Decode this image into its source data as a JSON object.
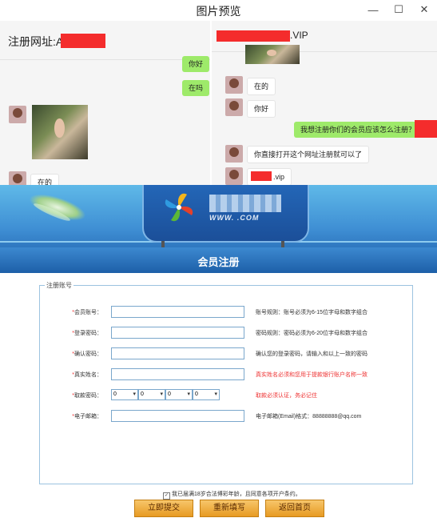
{
  "window": {
    "title": "图片预览"
  },
  "chat_left": {
    "header": "注册网址:AG",
    "messages": [
      {
        "text": "你好"
      },
      {
        "text": "在吗"
      },
      {
        "text": "在的"
      }
    ]
  },
  "chat_right": {
    "header_suffix": ".VIP",
    "messages": [
      {
        "text": "在的"
      },
      {
        "text": "你好"
      },
      {
        "text": "我想注册你们的会员应该怎么注册？"
      },
      {
        "text": "你直接打开这个网址注册就可以了"
      },
      {
        "text": ".vip"
      }
    ]
  },
  "site": {
    "logo_url": "WWW.        .COM",
    "section_title": "会员注册",
    "fieldset_legend": "注册账号",
    "fields": [
      {
        "label": "会员账号：",
        "hint": "账号规则：账号必须为6-15位字母和数字组合",
        "hint_red": false
      },
      {
        "label": "登录密码：",
        "hint": "密码规则：密码必须为6-20位字母和数字组合",
        "hint_red": false
      },
      {
        "label": "确认密码：",
        "hint": "确认您的登录密码，请输入和以上一致的密码",
        "hint_red": false
      },
      {
        "label": "真实姓名：",
        "hint": "真实姓名必须和您用于提款银行账户名称一致",
        "hint_red": true
      },
      {
        "label": "取款密码：",
        "hint": "取款必须认证，务必记住",
        "hint_red": true
      },
      {
        "label": "电子邮箱：",
        "hint": "电子邮箱(Email)格式：88888888@qq.com",
        "hint_red": false
      }
    ],
    "pin_options": [
      "0",
      "0",
      "0",
      "0"
    ],
    "agree_text": "我已届满18岁合法博彩年龄，且同意各项开户条约。",
    "buttons": {
      "submit": "立即提交",
      "reset": "重新填写",
      "home": "返回首页"
    }
  },
  "colors": {
    "redact": "#f42c2c",
    "bubble_green": "#9eea6a",
    "button_orange": "#e79a23",
    "banner_blue": "#3f8fd4"
  }
}
